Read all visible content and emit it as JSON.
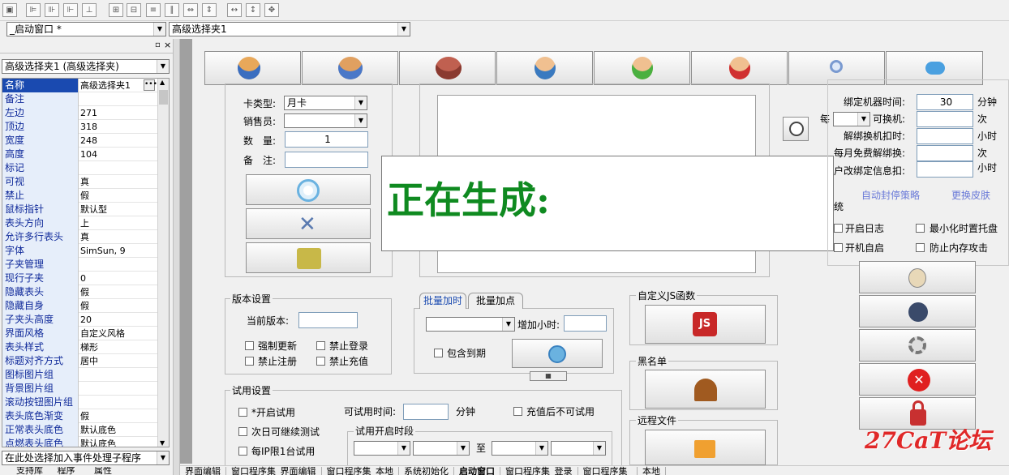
{
  "toolbar": {
    "icons": [
      "window-icon",
      "align-left-icon",
      "align-center-icon",
      "align-right-icon",
      "align-bottom-icon",
      "center-h-icon",
      "center-v-icon",
      "space-h-icon",
      "space-v-icon",
      "dist-h-icon",
      "dist-v-icon",
      "same-width-icon",
      "same-height-icon",
      "same-size-icon"
    ]
  },
  "selectors": {
    "form": "_启动窗口 *",
    "control": "高级选择夹1"
  },
  "props": {
    "header": "高级选择夹1 (高级选择夹)",
    "rows": [
      {
        "k": "名称",
        "v": "高级选择夹1"
      },
      {
        "k": "备注",
        "v": ""
      },
      {
        "k": "左边",
        "v": "271"
      },
      {
        "k": "顶边",
        "v": "318"
      },
      {
        "k": "宽度",
        "v": "248"
      },
      {
        "k": "高度",
        "v": "104"
      },
      {
        "k": "标记",
        "v": ""
      },
      {
        "k": "可视",
        "v": "真"
      },
      {
        "k": "禁止",
        "v": "假"
      },
      {
        "k": "鼠标指针",
        "v": "默认型"
      },
      {
        "k": "表头方向",
        "v": "上"
      },
      {
        "k": "允许多行表头",
        "v": "真"
      },
      {
        "k": "字体",
        "v": "SimSun, 9"
      },
      {
        "k": "子夹管理",
        "v": ""
      },
      {
        "k": "现行子夹",
        "v": "0"
      },
      {
        "k": "隐藏表头",
        "v": "假"
      },
      {
        "k": "隐藏自身",
        "v": "假"
      },
      {
        "k": "子夹头高度",
        "v": "20"
      },
      {
        "k": "界面风格",
        "v": "自定义风格"
      },
      {
        "k": "  表头样式",
        "v": "梯形"
      },
      {
        "k": "标题对齐方式",
        "v": "居中"
      },
      {
        "k": "图标图片组",
        "v": ""
      },
      {
        "k": "背景图片组",
        "v": ""
      },
      {
        "k": "滚动按钮图片组",
        "v": ""
      },
      {
        "k": "表头底色渐变",
        "v": "假"
      },
      {
        "k": "正常表头底色",
        "v": "默认底色"
      },
      {
        "k": "点燃表头底色",
        "v": "默认底色"
      }
    ],
    "event_select": "在此处选择加入事件处理子程序",
    "bottom_tabs": [
      "支持库",
      "程序",
      "属性"
    ]
  },
  "card": {
    "type_label": "卡类型:",
    "type_value": "月卡",
    "seller_label": "销售员:",
    "qty_label": "数　量:",
    "qty_value": "1",
    "note_label": "备　注:"
  },
  "overlay": {
    "text": "正在生成:"
  },
  "binding": {
    "bind_time_label": "绑定机器时间:",
    "bind_time_value": "30",
    "bind_time_unit": "分钟",
    "per_label": "每",
    "switch_label": "可换机:",
    "switch_unit": "次",
    "unbind_label": "解绑换机扣时:",
    "unbind_unit": "小时",
    "free_label": "每月免费解绑换:",
    "free_unit": "次",
    "modify_label": "户改绑定信息扣:",
    "modify_unit": "小时",
    "link1": "自动封停策略",
    "link2": "更换皮肤",
    "sys_label": "统",
    "log_label": "开启日志",
    "tray_label": "最小化时置托盘",
    "boot_label": "开机自启",
    "mem_label": "防止内存攻击"
  },
  "version": {
    "title": "版本设置",
    "cur_label": "当前版本:",
    "force_label": "强制更新",
    "nologin_label": "禁止登录",
    "noreg_label": "禁止注册",
    "nocharge_label": "禁止充值"
  },
  "batch": {
    "tab1": "批量加时",
    "tab2": "批量加点",
    "hours_label": "增加小时:",
    "expired_label": "包含到期"
  },
  "js": {
    "title": "自定义JS函数",
    "btn": "JS"
  },
  "blacklist": {
    "title": "黑名单"
  },
  "remote": {
    "title": "远程文件"
  },
  "trial": {
    "title": "试用设置",
    "enable_label": "*开启试用",
    "time_label": "可试用时间:",
    "time_unit": "分钟",
    "no_after_charge": "充值后不可试用",
    "next_day": "次日可继续测试",
    "per_ip": "每IP限1台试用",
    "period_title": "试用开启时段",
    "to_label": "至"
  },
  "bottom_tabs": [
    "界面编辑",
    "窗口程序集_界面编辑",
    "窗口程序集_本地",
    "系统初始化",
    "启动窗口",
    "窗口程序集_登录",
    "窗口程序集_",
    "本地"
  ],
  "watermark": "27CaT论坛"
}
